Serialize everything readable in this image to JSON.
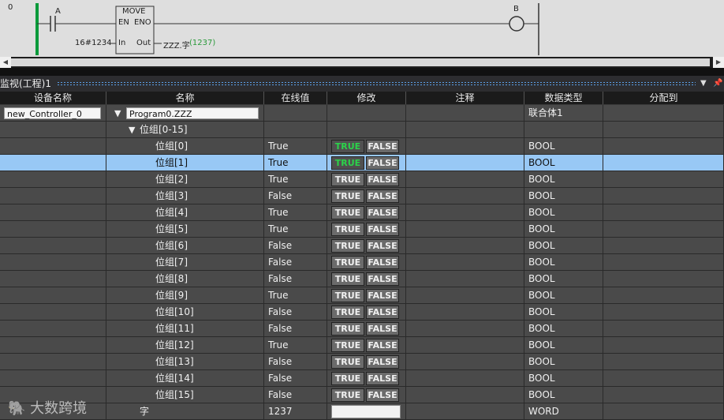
{
  "ladder": {
    "rung_number": "0",
    "contact_label": "A",
    "block_name": "MOVE",
    "en_label": "EN",
    "eno_label": "ENO",
    "in_label": "In",
    "out_label": "Out",
    "in_value": "16#1234",
    "out_var": "ZZZ.字",
    "out_value": "(1237)",
    "coil_label": "B"
  },
  "monitor": {
    "title": "监视(工程)1",
    "pin_icon": "pin-icon",
    "dropdown_icon": "triangle-down-icon"
  },
  "columns": [
    "设备名称",
    "名称",
    "在线值",
    "修改",
    "注释",
    "数据类型",
    "分配到"
  ],
  "buttons": {
    "true_label": "TRUE",
    "false_label": "FALSE"
  },
  "top_rows": [
    {
      "device": "new_Controller_0",
      "name": "Program0.ZZZ",
      "value": "",
      "type": "联合体1"
    },
    {
      "device": "",
      "name": "位组[0-15]",
      "value": "",
      "type": ""
    }
  ],
  "bits": [
    {
      "name": "位组[0]",
      "value": "True",
      "type": "BOOL"
    },
    {
      "name": "位组[1]",
      "value": "True",
      "type": "BOOL"
    },
    {
      "name": "位组[2]",
      "value": "True",
      "type": "BOOL"
    },
    {
      "name": "位组[3]",
      "value": "False",
      "type": "BOOL"
    },
    {
      "name": "位组[4]",
      "value": "True",
      "type": "BOOL"
    },
    {
      "name": "位组[5]",
      "value": "True",
      "type": "BOOL"
    },
    {
      "name": "位组[6]",
      "value": "False",
      "type": "BOOL"
    },
    {
      "name": "位组[7]",
      "value": "False",
      "type": "BOOL"
    },
    {
      "name": "位组[8]",
      "value": "False",
      "type": "BOOL"
    },
    {
      "name": "位组[9]",
      "value": "True",
      "type": "BOOL"
    },
    {
      "name": "位组[10]",
      "value": "False",
      "type": "BOOL"
    },
    {
      "name": "位组[11]",
      "value": "False",
      "type": "BOOL"
    },
    {
      "name": "位组[12]",
      "value": "True",
      "type": "BOOL"
    },
    {
      "name": "位组[13]",
      "value": "False",
      "type": "BOOL"
    },
    {
      "name": "位组[14]",
      "value": "False",
      "type": "BOOL"
    },
    {
      "name": "位组[15]",
      "value": "False",
      "type": "BOOL"
    }
  ],
  "word_row": {
    "name": "字",
    "value": "1237",
    "type": "WORD"
  },
  "watermark": "大数跨境",
  "colors": {
    "true_active": "#2bd34a",
    "selected_row": "#98c8f5",
    "rung_green": "#0a9a3a"
  }
}
